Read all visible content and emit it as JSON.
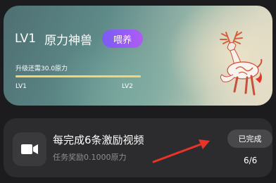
{
  "pet": {
    "level": "LV1",
    "name": "原力神兽",
    "feed_label": "喂养",
    "upgrade_text": "升级还需30.0原力",
    "progress": 1.0,
    "level_start": "LV1",
    "level_end": "LV2",
    "image_icon": "deer-illustration",
    "colors": {
      "progress": "#f4d37a",
      "feed_button": "#8b5cf6"
    }
  },
  "task": {
    "icon": "video-camera-icon",
    "title": "每完成6条激励视频",
    "reward": "任务奖励0.1000原力",
    "status_label": "已完成",
    "count": "6/6"
  },
  "annotation": {
    "icon": "red-arrow",
    "color": "#e8332a"
  }
}
